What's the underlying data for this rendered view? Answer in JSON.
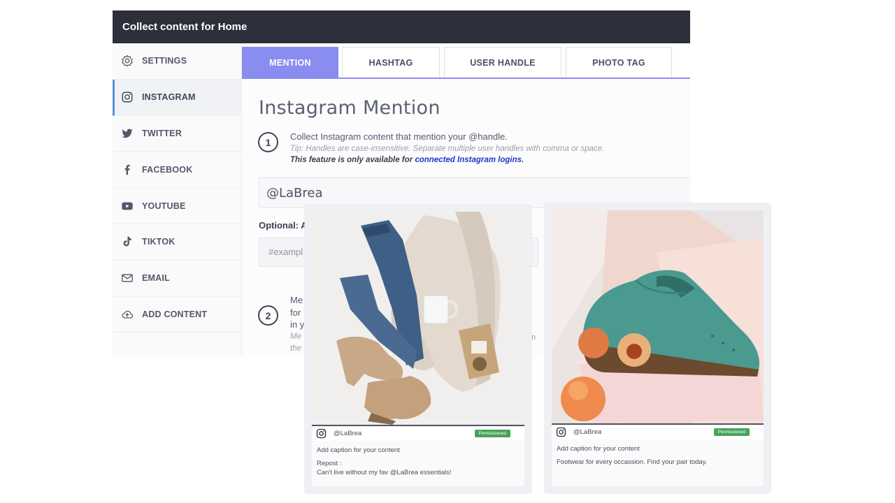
{
  "window": {
    "title": "Collect content for Home"
  },
  "sidebar": {
    "items": [
      {
        "label": "SETTINGS",
        "icon": "gear-icon"
      },
      {
        "label": "INSTAGRAM",
        "icon": "instagram-icon",
        "active": true
      },
      {
        "label": "TWITTER",
        "icon": "twitter-icon"
      },
      {
        "label": "FACEBOOK",
        "icon": "facebook-icon"
      },
      {
        "label": "YOUTUBE",
        "icon": "youtube-icon"
      },
      {
        "label": "TIKTOK",
        "icon": "tiktok-icon"
      },
      {
        "label": "EMAIL",
        "icon": "mail-icon"
      },
      {
        "label": "ADD CONTENT",
        "icon": "cloud-upload-icon"
      }
    ]
  },
  "tabs": [
    {
      "label": "MENTION",
      "active": true
    },
    {
      "label": "HASHTAG"
    },
    {
      "label": "USER HANDLE"
    },
    {
      "label": "PHOTO TAG"
    }
  ],
  "main": {
    "title": "Instagram Mention",
    "step1": {
      "number": "1",
      "text": "Collect Instagram content that mention your @handle.",
      "tip": "Tip: Handles are case-insensitive. Separate multiple user handles with comma or space.",
      "note": "This feature is only available for ",
      "note_link": "connected Instagram logins",
      "note_end": "."
    },
    "handle_value": "@LaBrea",
    "optional_label": "Optional: A",
    "tag_placeholder": "#exampl",
    "step2": {
      "number": "2",
      "lines": [
        "Me",
        "for",
        "in y"
      ],
      "italic_lines": [
        "Me",
        "the"
      ],
      "stray": "n"
    }
  },
  "cards": [
    {
      "username": "@LaBrea",
      "badge": "Permissioned",
      "caption_placeholder": "Add caption for your content",
      "caption_lines": [
        "Repost :",
        "Can't live without my fav @LaBrea essentials!"
      ]
    },
    {
      "username": "@LaBrea",
      "badge": "Permissioned",
      "caption_placeholder": "Add caption for your content",
      "caption_lines": [
        "Footwear for every occassion. Find your pair today."
      ]
    }
  ],
  "colors": {
    "titlebar": "#2d2f3a",
    "accent": "#8a8df0",
    "active_border": "#5b8fd8",
    "link": "#1c39c8",
    "badge": "#47a35a"
  }
}
